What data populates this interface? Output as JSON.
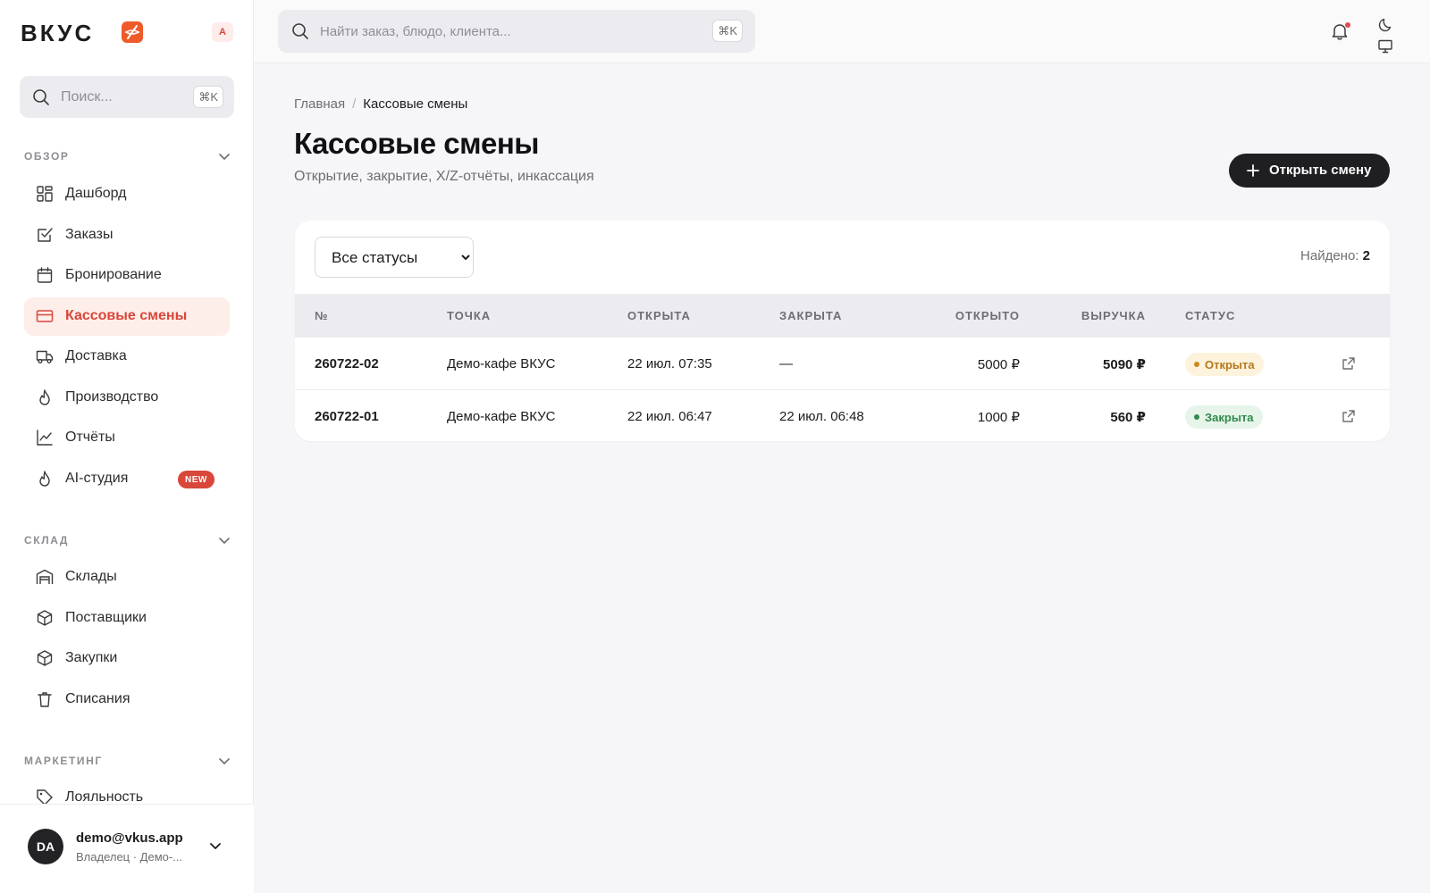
{
  "brand": {
    "name": "ВКУС",
    "workspace_badge": "A",
    "accent": "#d9473a"
  },
  "sidebar": {
    "search": {
      "placeholder": "Поиск...",
      "shortcut": "⌘K"
    },
    "sections": [
      {
        "title": "ОБЗОР",
        "items": [
          {
            "label": "Дашборд",
            "icon": "dashboard-icon"
          },
          {
            "label": "Заказы",
            "icon": "orders-check-icon"
          },
          {
            "label": "Бронирование",
            "icon": "calendar-icon"
          },
          {
            "label": "Кассовые смены",
            "icon": "card-icon",
            "active": true
          },
          {
            "label": "Доставка",
            "icon": "truck-icon"
          },
          {
            "label": "Производство",
            "icon": "flame-icon"
          },
          {
            "label": "Отчёты",
            "icon": "chart-line-icon"
          },
          {
            "label": "AI-студия",
            "icon": "flame-icon",
            "badge": "NEW"
          }
        ]
      },
      {
        "title": "СКЛАД",
        "items": [
          {
            "label": "Склады",
            "icon": "warehouse-icon"
          },
          {
            "label": "Поставщики",
            "icon": "box-icon"
          },
          {
            "label": "Закупки",
            "icon": "box-icon"
          },
          {
            "label": "Списания",
            "icon": "trash-icon"
          }
        ]
      },
      {
        "title": "МАРКЕТИНГ",
        "items": [
          {
            "label": "Лояльность",
            "icon": "tag-icon"
          }
        ]
      }
    ],
    "user": {
      "initials": "DA",
      "email": "demo@vkus.app",
      "role": "Владелец · Демо-..."
    }
  },
  "topbar": {
    "search": {
      "placeholder": "Найти заказ, блюдо, клиента...",
      "shortcut": "⌘K"
    },
    "icons": [
      "bell-icon",
      "moon-icon",
      "monitor-icon"
    ]
  },
  "breadcrumb": {
    "home": "Главная",
    "separator": "/",
    "current": "Кассовые смены"
  },
  "page": {
    "title": "Кассовые смены",
    "subtitle": "Открытие, закрытие, X/Z-отчёты, инкассация",
    "primary_action": "Открыть смену"
  },
  "filter": {
    "selected": "Все статусы",
    "options": [
      "Все статусы"
    ],
    "found_label": "Найдено:",
    "found_count": "2"
  },
  "table": {
    "columns": [
      "№",
      "ТОЧКА",
      "ОТКРЫТА",
      "ЗАКРЫТА",
      "ОТКРЫТО",
      "ВЫРУЧКА",
      "СТАТУС"
    ],
    "rows": [
      {
        "number": "260722-02",
        "location": "Демо-кафе ВКУС",
        "opened_at": "22 июл. 07:35",
        "closed_at": "—",
        "opening_cash": "5000 ₽",
        "revenue": "5090 ₽",
        "status": "Открыта",
        "status_color": "#b5791b"
      },
      {
        "number": "260722-01",
        "location": "Демо-кафе ВКУС",
        "opened_at": "22 июл. 06:47",
        "closed_at": "22 июл. 06:48",
        "opening_cash": "1000 ₽",
        "revenue": "560 ₽",
        "status": "Закрыта",
        "status_color": "#2f8a4b"
      }
    ]
  }
}
